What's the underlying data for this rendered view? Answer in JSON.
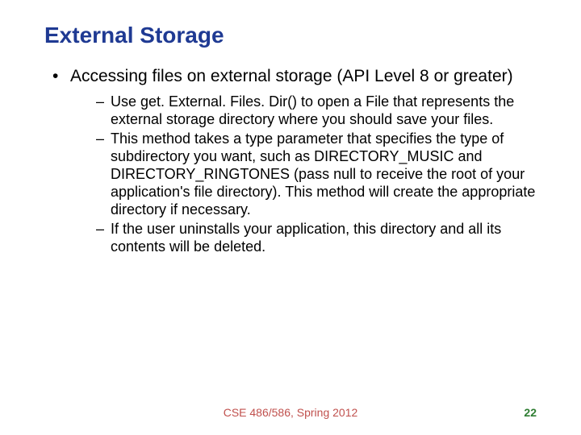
{
  "title": "External Storage",
  "bullets": [
    {
      "text": "Accessing files on external storage (API Level 8 or greater)",
      "subitems": [
        "Use get. External. Files. Dir() to open a File that represents the external storage directory where you should save your files.",
        "This method takes a type parameter that specifies the type of subdirectory you want, such as DIRECTORY_MUSIC and DIRECTORY_RINGTONES (pass null to receive the root of your application's file directory). This method will create the appropriate directory if necessary.",
        "If the user uninstalls your application, this directory and all its contents will be deleted."
      ]
    }
  ],
  "footer": "CSE 486/586, Spring 2012",
  "pageNumber": "22"
}
